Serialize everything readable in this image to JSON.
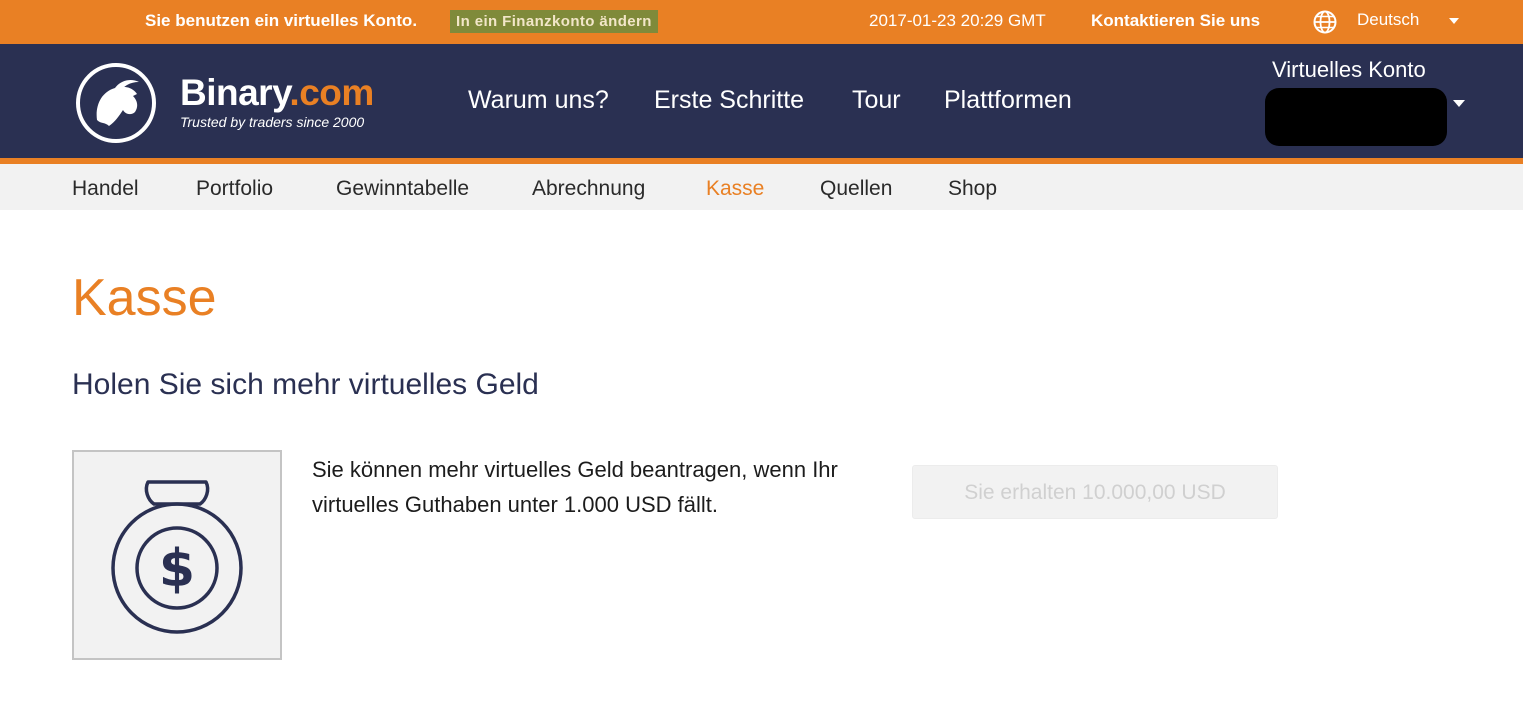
{
  "topbar": {
    "virtual_message": "Sie benutzen ein virtuelles Konto.",
    "switch_button": "In ein Finanzkonto ändern",
    "datetime": "2017-01-23 20:29 GMT",
    "contact": "Kontaktieren Sie uns",
    "language": "Deutsch",
    "language_icon": "globe-icon"
  },
  "header": {
    "brand_name": "Binary",
    "brand_suffix": ".com",
    "tagline": "Trusted by traders since 2000",
    "logo_icon": "bull-logo-icon",
    "nav": [
      "Warum uns?",
      "Erste Schritte",
      "Tour",
      "Plattformen"
    ],
    "account_title": "Virtuelles Konto"
  },
  "subnav": {
    "items": [
      "Handel",
      "Portfolio",
      "Gewinntabelle",
      "Abrechnung",
      "Kasse",
      "Quellen",
      "Shop"
    ],
    "active": "Kasse"
  },
  "main": {
    "title": "Kasse",
    "subheading": "Holen Sie sich mehr virtuelles Geld",
    "description": "Sie können mehr virtuelles Geld beantragen, wenn Ihr virtuelles Guthaben unter 1.000 USD fällt.",
    "illustration_icon": "money-bag-icon",
    "button_label": "Sie erhalten 10.000,00 USD"
  },
  "colors": {
    "orange": "#e98024",
    "navy": "#2a3052",
    "switch_bg": "#7f8a3a",
    "light_gray": "#f2f2f2"
  }
}
